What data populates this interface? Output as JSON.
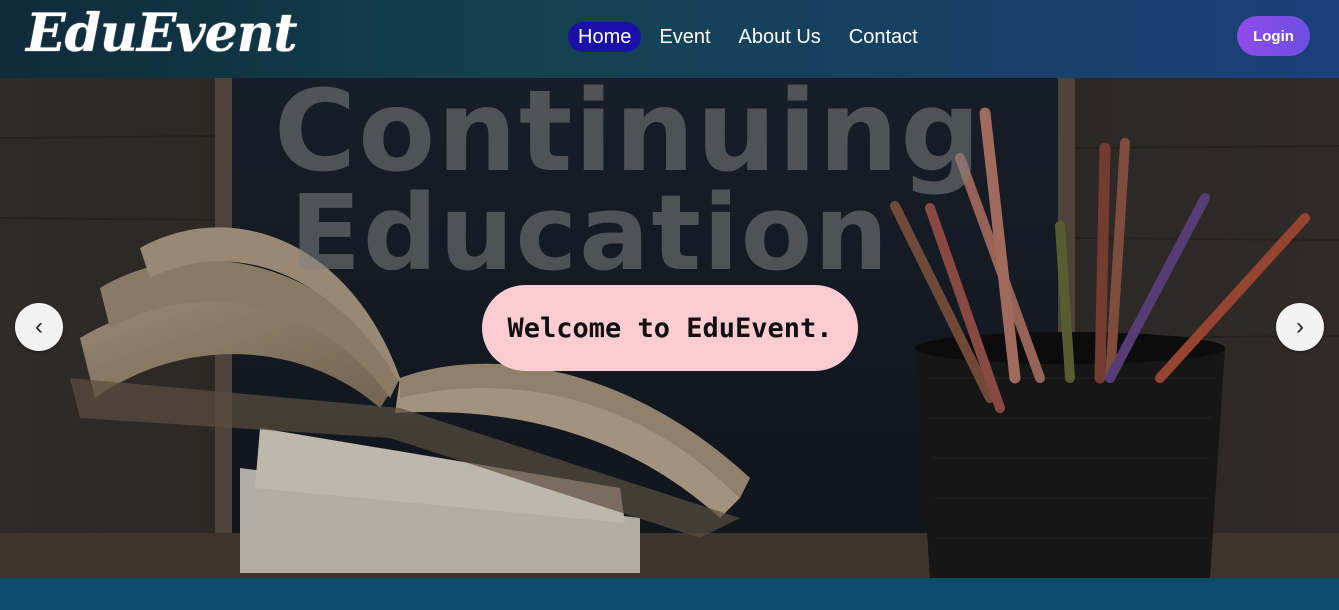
{
  "brand": {
    "logo_text": "EduEvent"
  },
  "nav": {
    "items": [
      {
        "label": "Home",
        "active": true
      },
      {
        "label": "Event",
        "active": false
      },
      {
        "label": "About Us",
        "active": false
      },
      {
        "label": "Contact",
        "active": false
      }
    ],
    "login_label": "Login"
  },
  "hero": {
    "chalkboard_line1": "Continuing",
    "chalkboard_line2": "Education",
    "welcome_text": "Welcome to EduEvent.",
    "prev_icon": "chevron-left-icon",
    "next_icon": "chevron-right-icon",
    "prev_glyph": "‹",
    "next_glyph": "›"
  },
  "colors": {
    "nav_active_bg": "#1a10a8",
    "login_gradient_start": "#8e4bea",
    "login_gradient_end": "#6c4fe0",
    "welcome_pill_bg": "#fbcdd3",
    "footer_bg": "#0c4a6e"
  }
}
